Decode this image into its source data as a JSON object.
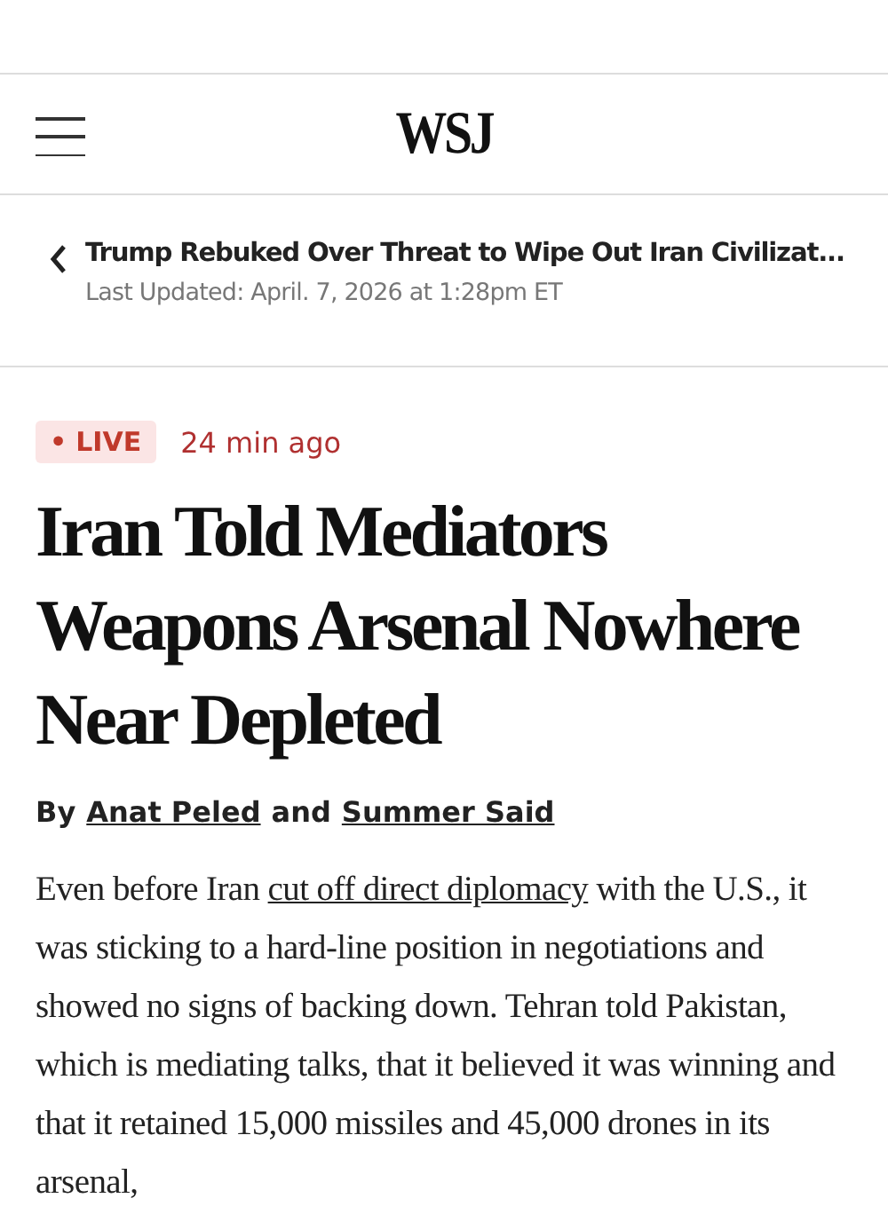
{
  "header": {
    "logo": "WSJ"
  },
  "back_nav": {
    "title": "Trump Rebuked Over Threat to Wipe Out Iran Civilizat...",
    "updated": "Last Updated: April. 7, 2026 at 1:28pm ET"
  },
  "article": {
    "badge": {
      "dot": "•",
      "label": "LIVE"
    },
    "time": "24 min ago",
    "headline": "Iran Told Mediators Weapons Arsenal Nowhere Near Depleted",
    "byline": {
      "prefix": "By",
      "authors": [
        "Anat Peled",
        "Summer Said"
      ],
      "joiner": "and"
    },
    "body": {
      "before": "Even before Iran ",
      "link": "cut off direct diplomacy",
      "after": " with the U.S., it was sticking to a hard-line position in negotiations and showed no signs of backing down. Tehran told Pakistan, which is mediating talks, that it believed it was winning and that it retained 15,000 missiles and 45,000 drones in its arsenal,"
    }
  }
}
